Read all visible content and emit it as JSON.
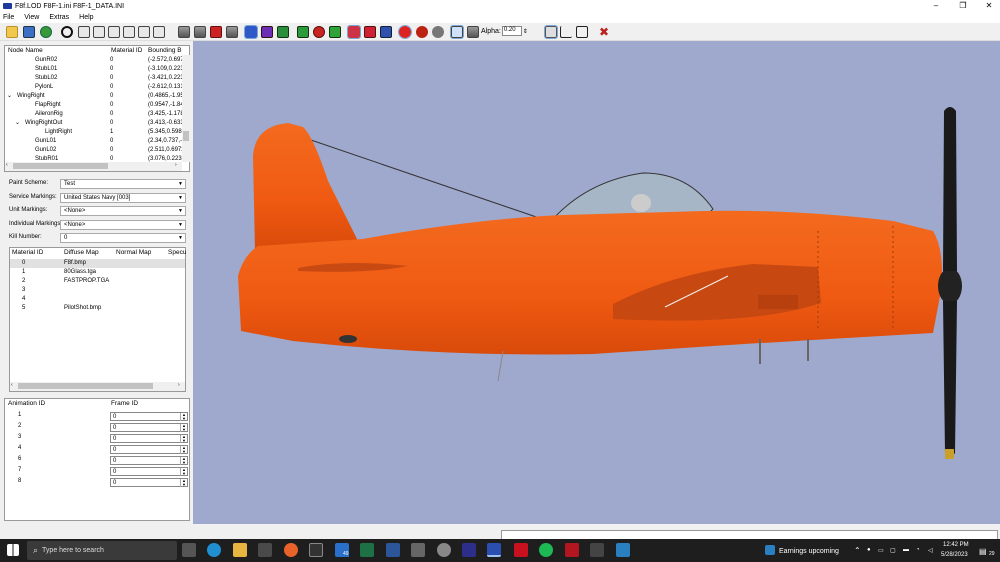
{
  "window": {
    "title": "F8f.LOD  F8F-1.ini  F8F-1_DATA.INI",
    "min": "–",
    "max": "❐",
    "close": "✕"
  },
  "menu": [
    "File",
    "View",
    "Extras",
    "Help"
  ],
  "toolbar": {
    "alpha_label": "Alpha:",
    "alpha_value": "0.20",
    "alpha_spinner": "⇕"
  },
  "node_tree": {
    "columns": [
      "Node Name",
      "Material ID",
      "Bounding B"
    ],
    "rows": [
      {
        "name": "GunR02",
        "exp": "",
        "mat": "0",
        "bb": "(-2.572,0.697"
      },
      {
        "name": "StubL01",
        "exp": "",
        "mat": "0",
        "bb": "(-3.109,0.223"
      },
      {
        "name": "StubL02",
        "exp": "",
        "mat": "0",
        "bb": "(-3.421,0.223"
      },
      {
        "name": "PylonL",
        "exp": "",
        "mat": "0",
        "bb": "(-2.612,0.131"
      },
      {
        "name": "WingRight",
        "exp": "⌄",
        "mat": "0",
        "bb": "(0.4865,-1.95"
      },
      {
        "name": "FlapRight",
        "exp": "",
        "mat": "0",
        "bb": "(0.9547,-1.84"
      },
      {
        "name": "AileronRig",
        "exp": "",
        "mat": "0",
        "bb": "(3.425,-1.178"
      },
      {
        "name": "WingRightOut",
        "exp": "⌄",
        "mat": "0",
        "bb": "(3.413,-0.633"
      },
      {
        "name": "LightRight",
        "exp": "",
        "mat": "1",
        "bb": "(5.345,0.5988"
      },
      {
        "name": "GunL01",
        "exp": "",
        "mat": "0",
        "bb": "(2.34,0.737,-("
      },
      {
        "name": "GunL02",
        "exp": "",
        "mat": "0",
        "bb": "(2.511,0.6972"
      },
      {
        "name": "StubR01",
        "exp": "",
        "mat": "0",
        "bb": "(3.076,0.2238"
      }
    ]
  },
  "markings": [
    {
      "label": "Paint Scheme:",
      "value": "Test"
    },
    {
      "label": "Service Markings:",
      "value": "United States Navy [003]"
    },
    {
      "label": "Unit Markings:",
      "value": "<None>"
    },
    {
      "label": "Individual Markings:",
      "value": "<None>"
    },
    {
      "label": "Kill Number:",
      "value": "0"
    }
  ],
  "material_table": {
    "columns": [
      "Material ID",
      "Diffuse Map",
      "Normal Map",
      "Specu"
    ],
    "rows": [
      {
        "id": "0",
        "diffuse": "F8f.bmp"
      },
      {
        "id": "1",
        "diffuse": "80Glass.tga"
      },
      {
        "id": "2",
        "diffuse": "FASTPROP.TGA"
      },
      {
        "id": "3",
        "diffuse": ""
      },
      {
        "id": "4",
        "diffuse": ""
      },
      {
        "id": "5",
        "diffuse": "PilotShot.bmp"
      }
    ]
  },
  "animation_table": {
    "columns": [
      "Animation ID",
      "Frame ID"
    ],
    "rows": [
      {
        "id": "1",
        "frame": "0"
      },
      {
        "id": "2",
        "frame": "0"
      },
      {
        "id": "3",
        "frame": "0"
      },
      {
        "id": "4",
        "frame": "0"
      },
      {
        "id": "6",
        "frame": "0"
      },
      {
        "id": "7",
        "frame": "0"
      },
      {
        "id": "8",
        "frame": "0"
      }
    ]
  },
  "colors": {
    "fuselage": "#f05a12",
    "viewport": "#9ea9cd",
    "propeller": "#1a1a1a"
  },
  "taskbar": {
    "search_placeholder": "Type here to search",
    "weather": "Earnings upcoming",
    "time": "12:42 PM",
    "date": "5/28/2023",
    "notification_count": "29",
    "mail_badge": "49"
  }
}
